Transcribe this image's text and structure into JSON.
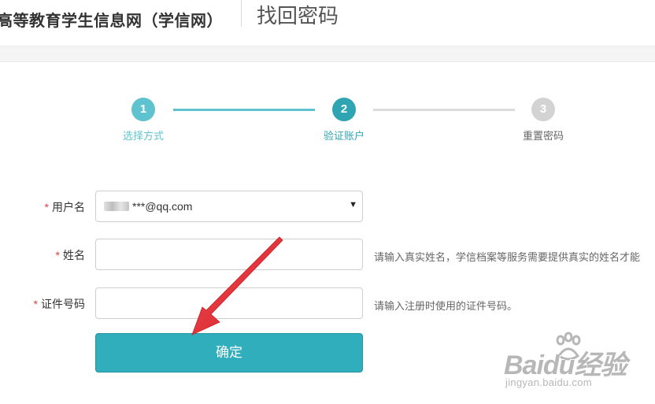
{
  "header": {
    "site_name": "高等教育学生信息网（学信网）",
    "page_title": "找回密码"
  },
  "steps": [
    {
      "number": "1",
      "label": "选择方式",
      "state": "done"
    },
    {
      "number": "2",
      "label": "验证账户",
      "state": "active"
    },
    {
      "number": "3",
      "label": "重置密码",
      "state": "pending"
    }
  ],
  "form": {
    "required_mark": "*",
    "username": {
      "label": "用户名",
      "value": "***@qq.com"
    },
    "name": {
      "label": "姓名",
      "value": "",
      "hint": "请输入真实姓名，学信档案等服务需要提供真实的姓名才能"
    },
    "id_number": {
      "label": "证件号码",
      "value": "",
      "hint": "请输入注册时使用的证件号码。"
    },
    "submit_label": "确定"
  },
  "watermark": {
    "main": "Baidu经验",
    "sub": "jingyan.baidu.com"
  },
  "colors": {
    "accent": "#31aebc",
    "step_done": "#5fc3cf",
    "step_pending": "#d3d3d3",
    "required": "#e04040",
    "annotation_arrow": "#e8373e"
  }
}
